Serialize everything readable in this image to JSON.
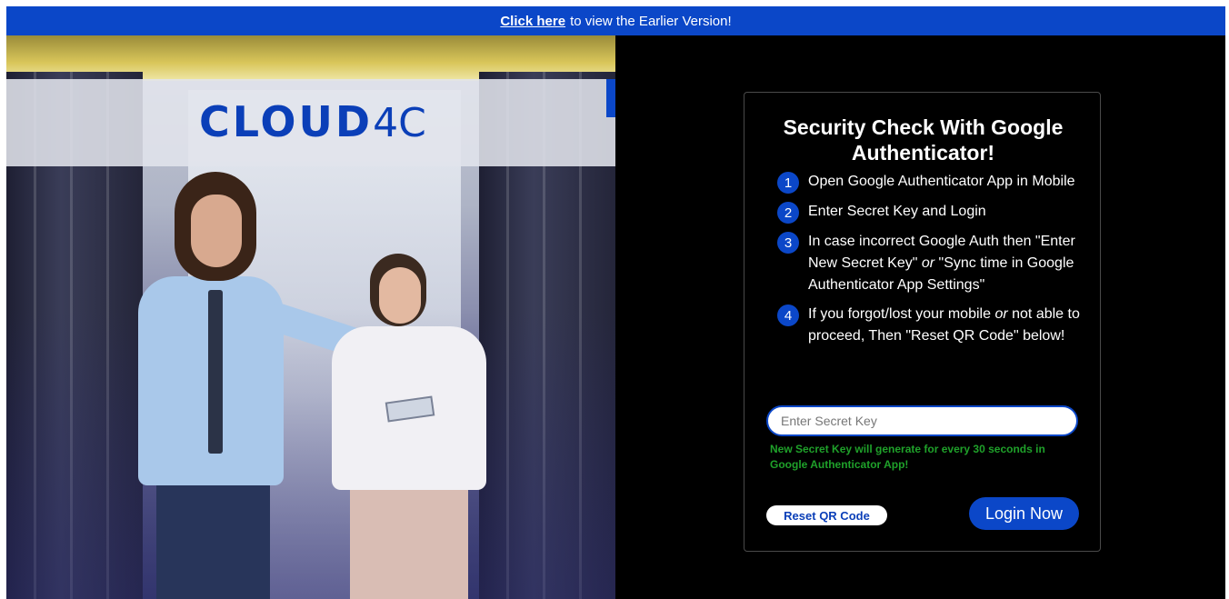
{
  "banner": {
    "link_label": "Click here",
    "text": "to view the Earlier Version!"
  },
  "brand": {
    "logo_text": "CLOUD",
    "logo_number": "4C"
  },
  "card": {
    "title": "Security Check With Google Authenticator!",
    "steps": [
      {
        "num": "1",
        "text": "Open Google Authenticator App in Mobile"
      },
      {
        "num": "2",
        "text": "Enter Secret Key and Login"
      },
      {
        "num": "3",
        "text_a": "In case incorrect Google Auth then \"Enter New Secret Key\"",
        "or": "or",
        "text_b": "\"Sync time in Google Authenticator App Settings\""
      },
      {
        "num": "4",
        "text_a": "If you forgot/lost your mobile",
        "or": "or",
        "text_b": "not able to proceed, Then \"Reset QR Code\" below!"
      }
    ],
    "secret_input": {
      "placeholder": "Enter Secret Key",
      "value": ""
    },
    "hint": "New Secret Key will generate for every 30 seconds in Google Authenticator App!",
    "reset_label": "Reset QR Code",
    "login_label": "Login Now"
  },
  "colors": {
    "accent": "#0b47c8",
    "hint": "#1fa12a",
    "background": "#000000"
  }
}
